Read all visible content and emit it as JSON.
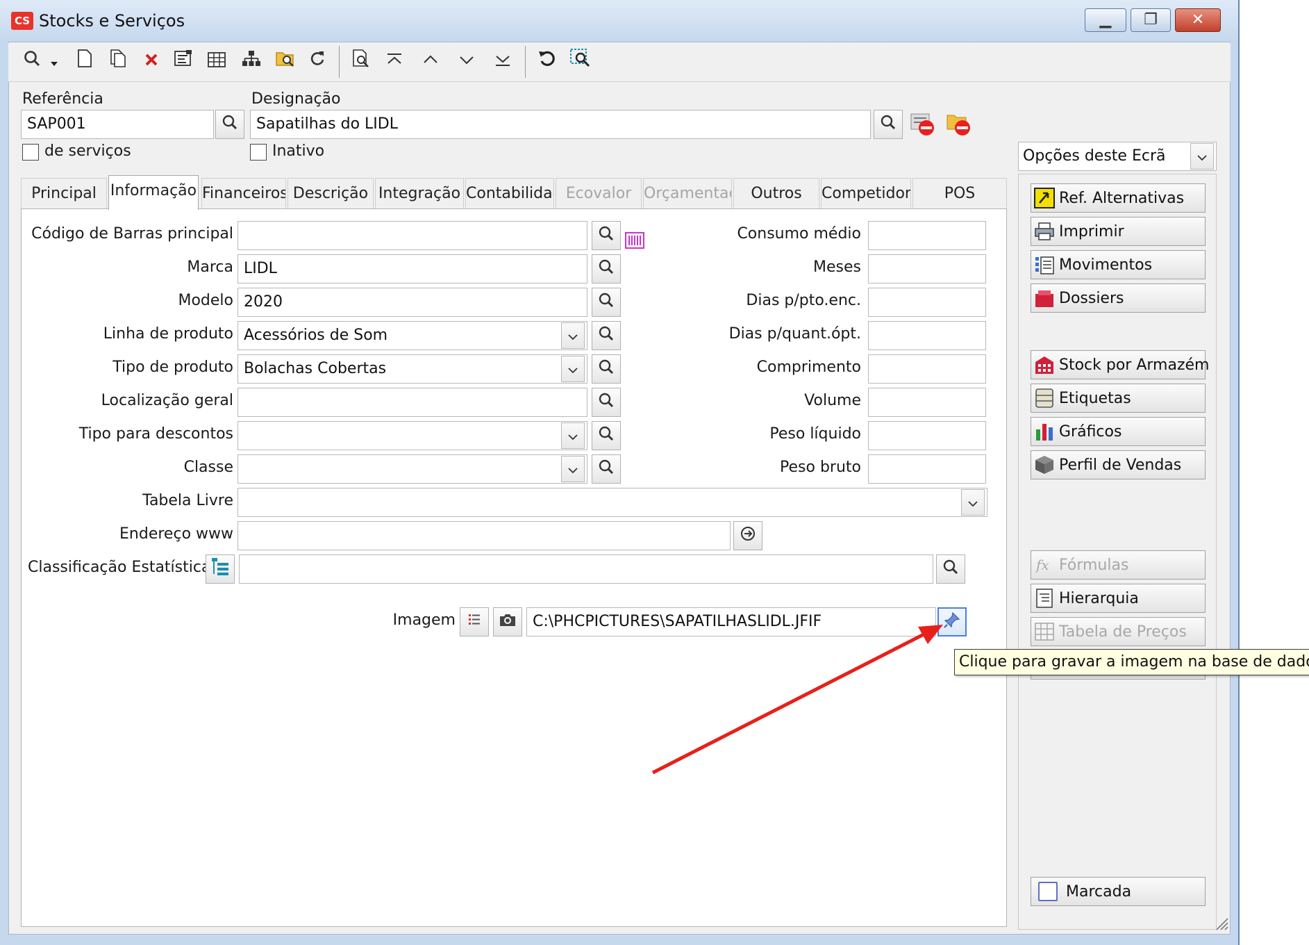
{
  "window": {
    "title": "Stocks e Serviços",
    "app_logo": "CS",
    "controls": {
      "minimize": "▁",
      "restore": "❐",
      "close": "✕"
    }
  },
  "toolbar": {
    "icons": [
      "search-icon",
      "dropdown-arrow-icon",
      "new-document-icon",
      "copy-document-icon",
      "delete-icon",
      "edit-form-icon",
      "grid-icon",
      "hierarchy-icon",
      "folder-search-icon",
      "refresh-icon",
      "preview-icon",
      "first-record-icon",
      "previous-record-icon",
      "next-record-icon",
      "last-record-icon",
      "reload-icon",
      "scan-icon"
    ]
  },
  "header": {
    "referencia_label": "Referência",
    "referencia_value": "SAP001",
    "designacao_label": "Designação",
    "designacao_value": "Sapatilhas do LIDL",
    "servicos_label": "de serviços",
    "inativo_label": "Inativo"
  },
  "tabs": [
    {
      "label": "Principal",
      "state": "normal"
    },
    {
      "label": "Informação",
      "state": "active"
    },
    {
      "label": "Financeiros",
      "state": "normal"
    },
    {
      "label": "Descrição",
      "state": "normal"
    },
    {
      "label": "Integração",
      "state": "normal"
    },
    {
      "label": "Contabilidade",
      "state": "normal"
    },
    {
      "label": "Ecovalor",
      "state": "disabled"
    },
    {
      "label": "Orçamentação",
      "state": "disabled"
    },
    {
      "label": "Outros",
      "state": "normal"
    },
    {
      "label": "Competidores",
      "state": "normal"
    },
    {
      "label": "POS",
      "state": "normal"
    }
  ],
  "form": {
    "codigo_barras": {
      "label": "Código de Barras principal",
      "value": ""
    },
    "marca": {
      "label": "Marca",
      "value": "LIDL"
    },
    "modelo": {
      "label": "Modelo",
      "value": "2020"
    },
    "linha_produto": {
      "label": "Linha de produto",
      "value": "Acessórios de Som"
    },
    "tipo_produto": {
      "label": "Tipo de produto",
      "value": "Bolachas Cobertas"
    },
    "localizacao": {
      "label": "Localização geral",
      "value": ""
    },
    "tipo_descontos": {
      "label": "Tipo para descontos",
      "value": ""
    },
    "classe": {
      "label": "Classe",
      "value": ""
    },
    "tabela_livre": {
      "label": "Tabela Livre",
      "value": ""
    },
    "endereco_www": {
      "label": "Endereço www",
      "value": ""
    },
    "classificacao": {
      "label": "Classificação Estatística",
      "value": ""
    },
    "imagem": {
      "label": "Imagem",
      "value": "C:\\PHCPICTURES\\SAPATILHASLIDL.JFIF"
    }
  },
  "right_fields": [
    {
      "label": "Consumo médio",
      "value": ""
    },
    {
      "label": "Meses",
      "value": ""
    },
    {
      "label": "Dias p/pto.enc.",
      "value": ""
    },
    {
      "label": "Dias p/quant.ópt.",
      "value": ""
    },
    {
      "label": "Comprimento",
      "value": ""
    },
    {
      "label": "Volume",
      "value": ""
    },
    {
      "label": "Peso líquido",
      "value": ""
    },
    {
      "label": "Peso bruto",
      "value": ""
    }
  ],
  "side": {
    "options_label": "Opções deste Ecrã",
    "buttons": [
      {
        "label": "Ref. Alternativas",
        "icon": "ref-alternativas-icon",
        "enabled": true
      },
      {
        "label": "Imprimir",
        "icon": "printer-icon",
        "enabled": true
      },
      {
        "label": "Movimentos",
        "icon": "movements-icon",
        "enabled": true
      },
      {
        "label": "Dossiers",
        "icon": "dossiers-icon",
        "enabled": true
      },
      {
        "label": "Stock por Armazém",
        "icon": "warehouse-icon",
        "enabled": true
      },
      {
        "label": "Etiquetas",
        "icon": "labels-icon",
        "enabled": true
      },
      {
        "label": "Gráficos",
        "icon": "bar-chart-icon",
        "enabled": true
      },
      {
        "label": "Perfil de Vendas",
        "icon": "sales-profile-icon",
        "enabled": true
      },
      {
        "label": "Fórmulas",
        "icon": "formula-icon",
        "enabled": false
      },
      {
        "label": "Hierarquia",
        "icon": "hierarchy-doc-icon",
        "enabled": true
      },
      {
        "label": "Tabela de Preços",
        "icon": "price-table-icon",
        "enabled": false
      }
    ],
    "marcada_label": "Marcada"
  },
  "tooltip": "Clique para gravar a imagem na base de dados",
  "colors": {
    "accent_red": "#e8332a",
    "arrow": "#e8201a",
    "magenta_barcode": "#cc33cc",
    "teal_tree": "#1a8fb0"
  }
}
